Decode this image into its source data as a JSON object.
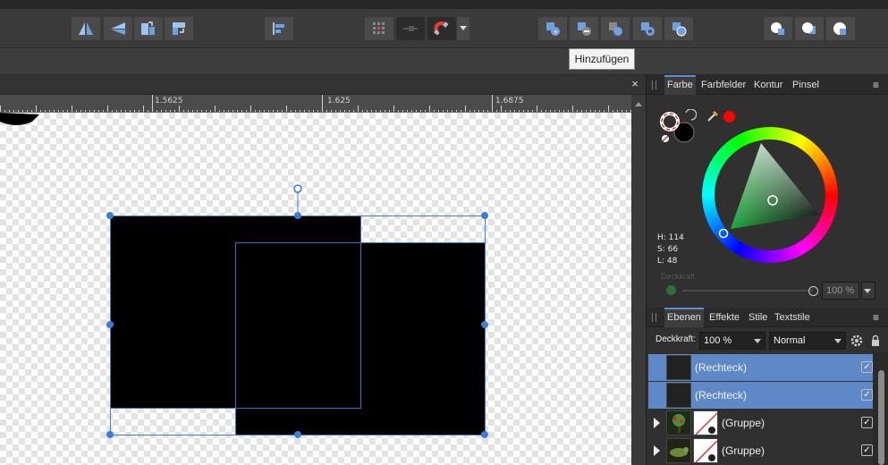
{
  "tooltip": {
    "text": "Hinzufügen"
  },
  "toolbar": {
    "groups": [
      {
        "name": "flip",
        "items": [
          "flip-horizontal",
          "flip-vertical",
          "rotate-counterclockwise",
          "rotate-clockwise"
        ]
      },
      {
        "name": "align",
        "items": [
          "align-left"
        ]
      },
      {
        "name": "snapping",
        "items": [
          "grid-snapping",
          "snapping-toggle",
          "snapping-magnet",
          "snapping-options"
        ]
      },
      {
        "name": "boolean",
        "items": [
          "add",
          "subtract",
          "intersect",
          "xor",
          "divide"
        ]
      },
      {
        "name": "arrange",
        "items": [
          "move-forward",
          "move-back",
          "insert-behind"
        ]
      }
    ]
  },
  "document": {
    "close_symbol": "×"
  },
  "ruler": {
    "labels": [
      "1.5625",
      "1.625",
      "1.6875"
    ]
  },
  "color_panel": {
    "tabs": [
      "Farbe",
      "Farbfelder",
      "Kontur",
      "Pinsel"
    ],
    "active_tab": "Farbe",
    "hue": "H: 114",
    "saturation": "S: 66",
    "lightness": "L: 48",
    "opacity_label": "Deckkraft",
    "opacity_value": "100 %",
    "picker_color": "#ff0000",
    "fill_color": "#000000"
  },
  "layers_panel": {
    "tabs": [
      "Ebenen",
      "Effekte",
      "Stile",
      "Textstile"
    ],
    "active_tab": "Ebenen",
    "opacity_label": "Deckkraft:",
    "opacity_value": "100 %",
    "blend_mode": "Normal",
    "rows": [
      {
        "name": "(Rechteck)",
        "selected": true,
        "visible": "✓"
      },
      {
        "name": "(Rechteck)",
        "selected": true,
        "visible": "✓"
      },
      {
        "name": "(Gruppe)",
        "selected": false,
        "visible": "✓"
      },
      {
        "name": "(Gruppe)",
        "selected": false,
        "visible": "✓"
      }
    ]
  }
}
